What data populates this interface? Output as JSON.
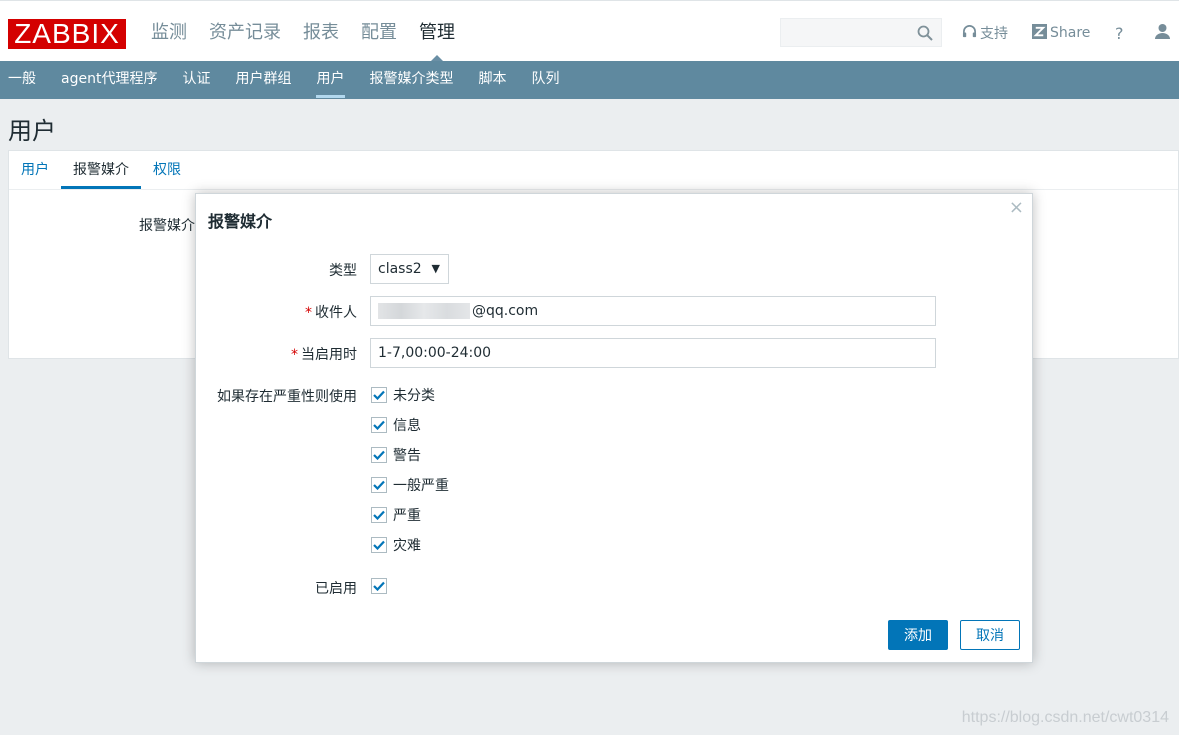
{
  "brand": {
    "logo": "ZABBIX",
    "color": "#d40000"
  },
  "main_nav": [
    "监测",
    "资产记录",
    "报表",
    "配置",
    "管理"
  ],
  "main_nav_active": "管理",
  "header_tools": {
    "support": "支持",
    "share": "Share",
    "help": "?"
  },
  "search": {
    "value": "",
    "placeholder": ""
  },
  "sub_nav": [
    "一般",
    "agent代理程序",
    "认证",
    "用户群组",
    "用户",
    "报警媒介类型",
    "脚本",
    "队列"
  ],
  "sub_nav_active": "用户",
  "page": {
    "title": "用户"
  },
  "tabs": [
    "用户",
    "报警媒介",
    "权限"
  ],
  "tabs_active": "报警媒介",
  "panel_label": "报警媒介",
  "dialog": {
    "title": "报警媒介",
    "close": "×",
    "type_label": "类型",
    "type_value": "class2",
    "recipient_label": "收件人",
    "recipient_value": "@qq.com",
    "when_active_label": "当启用时",
    "when_active_value": "1-7,00:00-24:00",
    "severity_label": "如果存在严重性则使用",
    "severities": [
      {
        "label": "未分类",
        "checked": true
      },
      {
        "label": "信息",
        "checked": true
      },
      {
        "label": "警告",
        "checked": true
      },
      {
        "label": "一般严重",
        "checked": true
      },
      {
        "label": "严重",
        "checked": true
      },
      {
        "label": "灾难",
        "checked": true
      }
    ],
    "enabled_label": "已启用",
    "enabled": true,
    "add_button": "添加",
    "cancel_button": "取消"
  },
  "watermark": "https://blog.csdn.net/cwt0314",
  "colors": {
    "subnav_bg": "#5f899f",
    "accent": "#0275b8",
    "required": "#d40000"
  }
}
